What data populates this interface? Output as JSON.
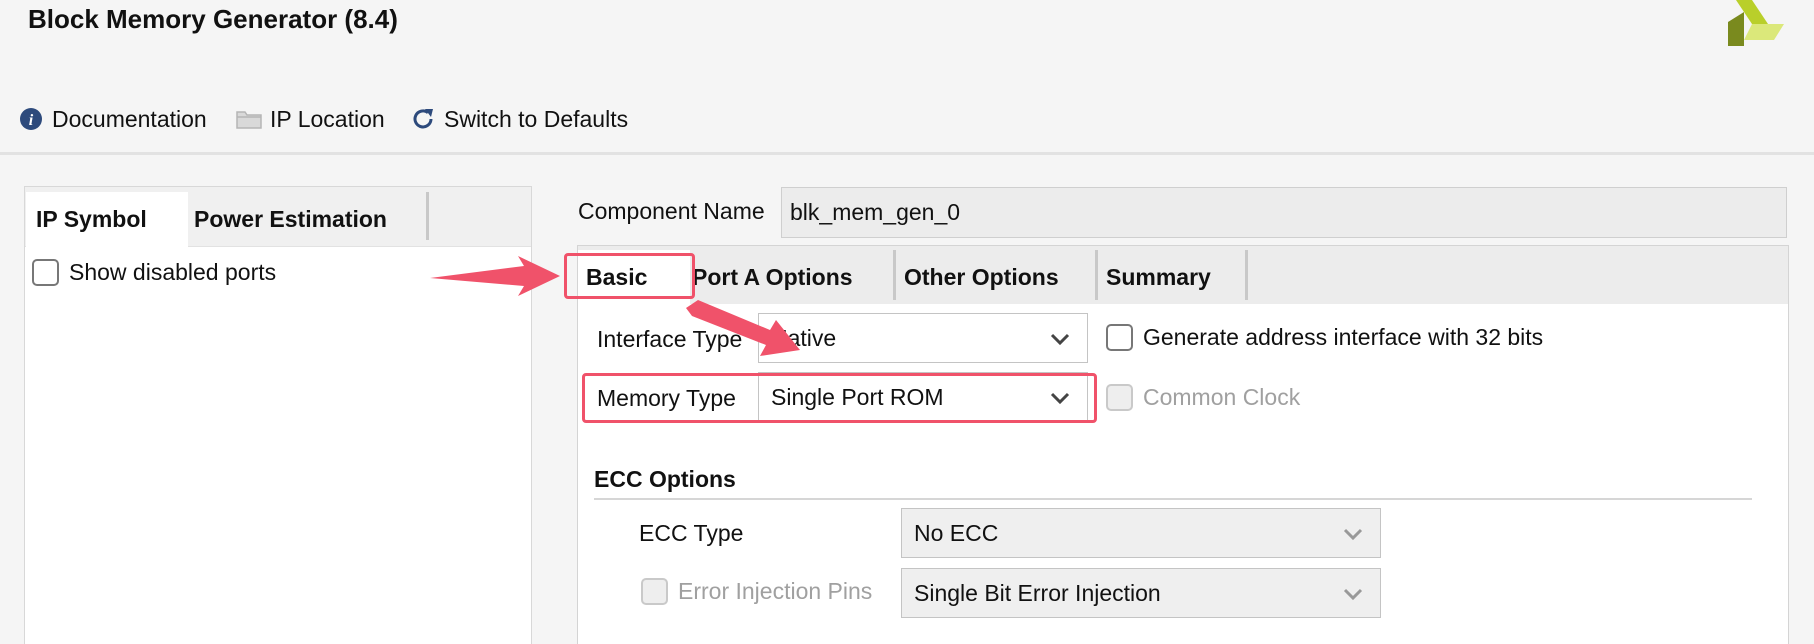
{
  "window": {
    "title": "Block Memory Generator (8.4)",
    "logo_icon": "xilinx-logo-icon"
  },
  "toolbar": {
    "documentation": "Documentation",
    "ip_location": "IP Location",
    "switch_defaults": "Switch to Defaults"
  },
  "left_panel": {
    "tabs": [
      {
        "label": "IP Symbol",
        "active": true
      },
      {
        "label": "Power Estimation",
        "active": false
      }
    ],
    "show_disabled_ports": {
      "label": "Show disabled ports",
      "checked": false
    }
  },
  "component": {
    "label": "Component Name",
    "value": "blk_mem_gen_0"
  },
  "right_panel": {
    "tabs": [
      {
        "label": "Basic",
        "active": true
      },
      {
        "label": "Port A Options",
        "active": false
      },
      {
        "label": "Other Options",
        "active": false
      },
      {
        "label": "Summary",
        "active": false
      }
    ],
    "interface_type": {
      "label": "Interface Type",
      "value": "Native"
    },
    "memory_type": {
      "label": "Memory Type",
      "value": "Single Port ROM"
    },
    "gen_addr_32": {
      "label": "Generate address interface with 32 bits",
      "checked": false
    },
    "common_clock": {
      "label": "Common Clock",
      "checked": false,
      "enabled": false
    },
    "ecc": {
      "section_title": "ECC Options",
      "ecc_type": {
        "label": "ECC Type",
        "value": "No ECC"
      },
      "error_injection": {
        "label": "Error Injection Pins",
        "value": "Single Bit Error Injection",
        "enabled": false
      }
    }
  },
  "colors": {
    "highlight": "#f0526a",
    "info_icon": "#2d4a7c",
    "refresh_icon": "#2d4a7c"
  }
}
